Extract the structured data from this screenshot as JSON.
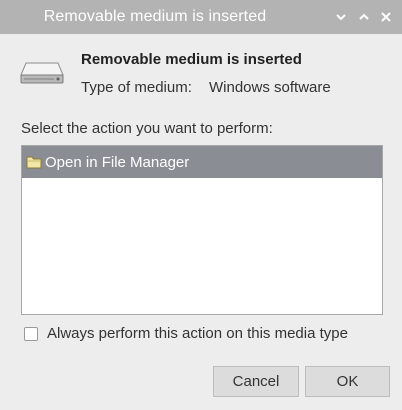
{
  "window": {
    "title": "Removable medium is inserted"
  },
  "header": {
    "icon": "removable-drive-icon",
    "heading": "Removable medium is inserted",
    "medium_label": "Type of medium:",
    "medium_value": "Windows software"
  },
  "action_prompt": "Select the action you want to perform:",
  "actions": [
    {
      "icon": "folder-icon",
      "label": "Open in File Manager",
      "selected": true
    }
  ],
  "always_option": {
    "label": "Always perform this action on this media type",
    "checked": false
  },
  "buttons": {
    "cancel": "Cancel",
    "ok": "OK"
  },
  "colors": {
    "titlebar": "#b3b3b3",
    "selection": "#8a8d94",
    "background": "#ededed"
  }
}
